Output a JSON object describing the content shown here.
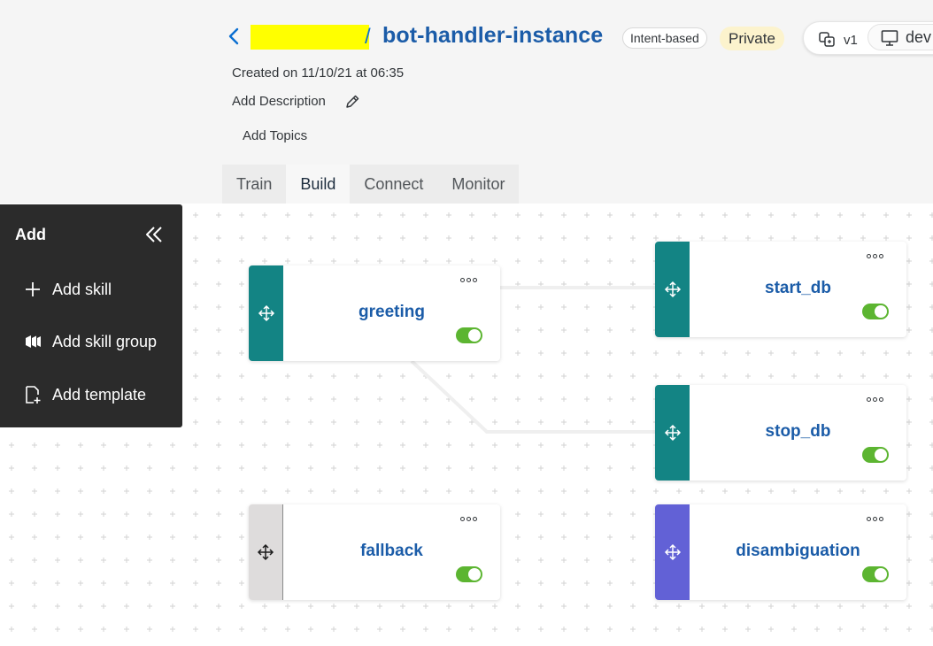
{
  "header": {
    "bot_name": "bot-handler-instance",
    "separator": "/",
    "tag_type": "Intent-based",
    "tag_visibility": "Private",
    "version": "v1",
    "environment": "dev",
    "created": "Created on 11/10/21 at 06:35",
    "add_description": "Add Description",
    "add_topics": "Add Topics"
  },
  "tabs": [
    {
      "label": "Train",
      "active": false
    },
    {
      "label": "Build",
      "active": true
    },
    {
      "label": "Connect",
      "active": false
    },
    {
      "label": "Monitor",
      "active": false
    }
  ],
  "add_panel": {
    "title": "Add",
    "items": [
      {
        "label": "Add skill",
        "icon": "plus-icon"
      },
      {
        "label": "Add skill group",
        "icon": "skill-group-icon"
      },
      {
        "label": "Add template",
        "icon": "template-icon"
      }
    ]
  },
  "skills": [
    {
      "name": "greeting",
      "color": "#138484",
      "enabled": true
    },
    {
      "name": "start_db",
      "color": "#138484",
      "enabled": true
    },
    {
      "name": "stop_db",
      "color": "#138484",
      "enabled": true
    },
    {
      "name": "fallback",
      "color": "#dedcdc",
      "enabled": true
    },
    {
      "name": "disambiguation",
      "color": "#6261d6",
      "enabled": true
    }
  ],
  "colors": {
    "accent_blue": "#1b5ca8",
    "toggle_on": "#5cb531",
    "panel_bg": "#2b2b2b",
    "private_tag_bg": "#fcf3cd",
    "redaction": "#ffff00"
  }
}
